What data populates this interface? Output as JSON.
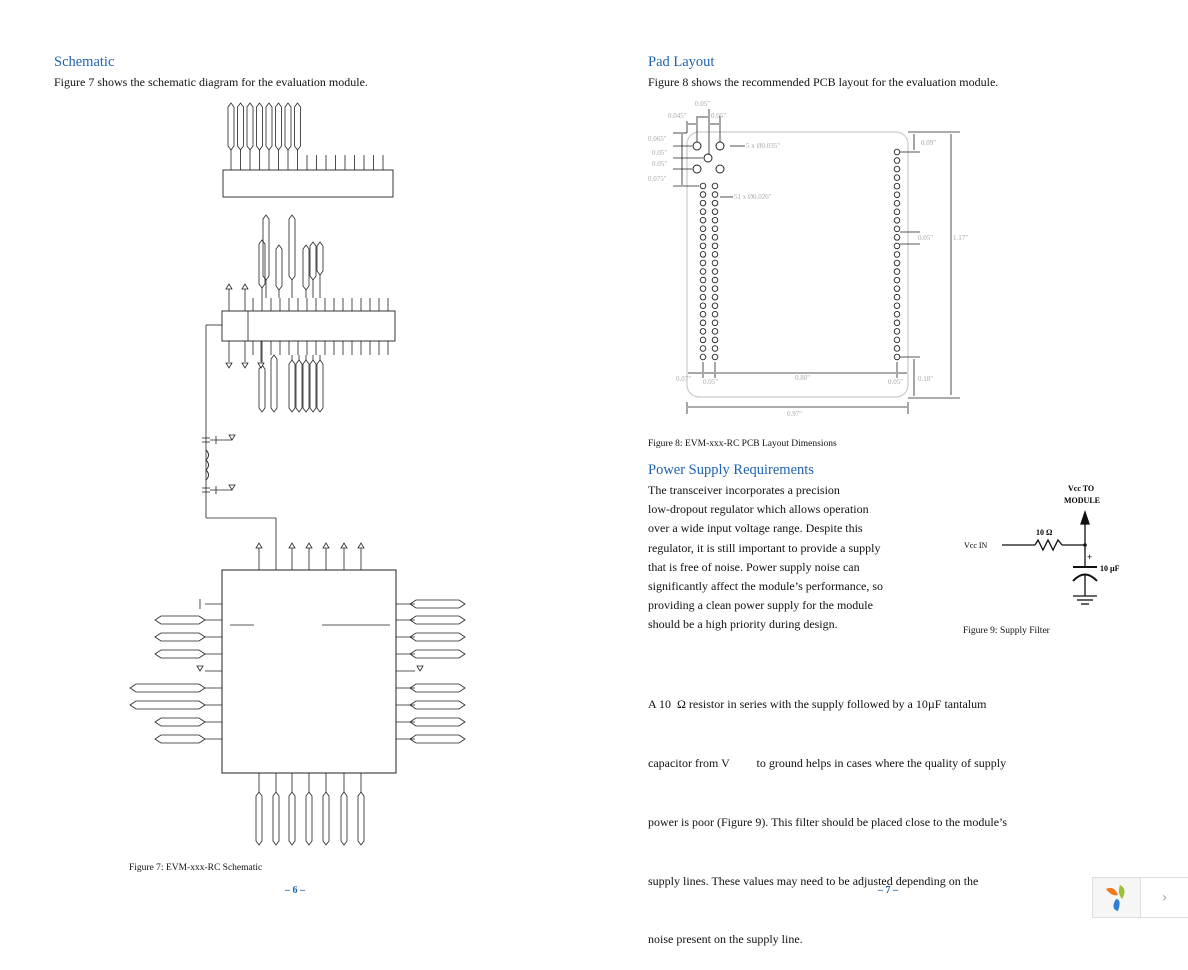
{
  "left_page": {
    "heading": "Schematic",
    "intro": "Figure 7 shows the schematic diagram for the evaluation module.",
    "figure_caption": "Figure 7: EVM-xxx-RC Schematic",
    "page_number": "– 6 –"
  },
  "right_page": {
    "pad_heading": "Pad Layout",
    "pad_intro": "Figure 8 shows the recommended PCB layout for the evaluation module.",
    "pcb": {
      "dims": {
        "top_pitch": "0.05\"",
        "left_offset": "0.045\"",
        "right_pitch": "0.05\"",
        "v1": "0.065\"",
        "v2": "0.05\"",
        "v3": "0.05\"",
        "v4": "0.075\"",
        "big_holes": "5 x Ø0.035\"",
        "small_holes": "51 x Ø0.026\"",
        "top_right": "0.09\"",
        "pin_pitch": "0.05\"",
        "height": "1.17\"",
        "bottom_left": "0.07\"",
        "bottom_pitch": "0.05\"",
        "column_span": "0.80\"",
        "bottom_right": "0.05\"",
        "bottom_gap": "0.18\"",
        "width": "0.97\""
      }
    },
    "pcb_caption": "Figure 8: EVM-xxx-RC PCB Layout Dimensions",
    "power_heading": "Power Supply Requirements",
    "power_lines": [
      "The transceiver incorporates a precision",
      "low-dropout regulator which allows operation",
      "over a wide input voltage range. Despite this",
      "regulator, it is still important to provide a supply",
      "that is free of noise. Power supply noise can",
      "significantly affect the module’s performance, so",
      "providing a clean power supply for the module",
      "should be a high priority during design."
    ],
    "filter": {
      "vcc_out_1": "Vcc TO",
      "vcc_out_2": "MODULE",
      "resistor": "10 Ω",
      "vcc_in": "Vcc IN",
      "plus": "+",
      "capacitor": "10 µF",
      "caption": "Figure 9: Supply Filter"
    },
    "para2_lines": [
      "A 10  Ω resistor in series with the supply followed by a 10µF tantalum",
      "capacitor from V         to ground helps in cases where the quality of supply",
      "power is poor (Figure 9). This filter should be placed close to the module’s",
      "supply lines. These values may need to be adjusted depending on the",
      "noise present on the supply line."
    ],
    "page_number": "– 7 –"
  },
  "viewer": {
    "logo_icon": "app-logo-icon",
    "next_icon": "chevron-right-icon",
    "next_label": "›"
  },
  "colors": {
    "heading": "#1e63b0",
    "page_number": "#1e63b0"
  }
}
